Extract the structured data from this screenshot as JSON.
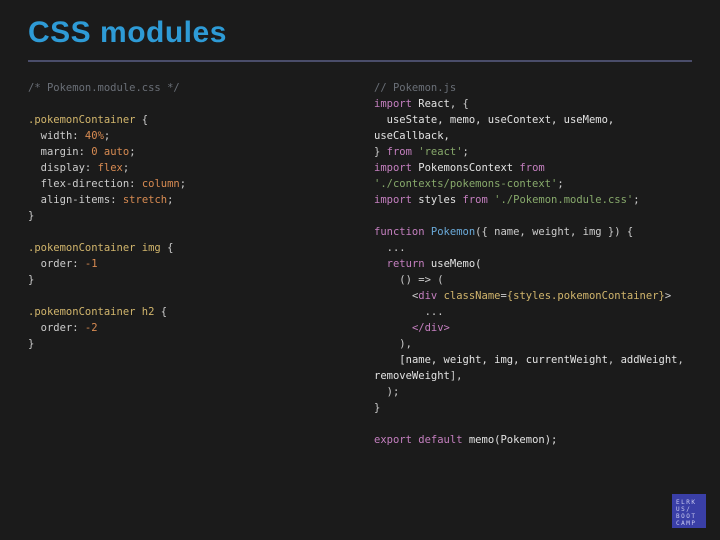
{
  "title": "CSS modules",
  "left": {
    "file": "Pokemon.module.css",
    "comment": "/* Pokemon.module.css */",
    "rules": [
      {
        "selector": ".pokemonContainer",
        "decls": [
          {
            "p": "width",
            "v": "40%"
          },
          {
            "p": "margin",
            "v": "0 auto"
          },
          {
            "p": "display",
            "v": "flex"
          },
          {
            "p": "flex-direction",
            "v": "column"
          },
          {
            "p": "align-items",
            "v": "stretch"
          }
        ]
      },
      {
        "selector": ".pokemonContainer img",
        "decls": [
          {
            "p": "order",
            "v": "-1"
          }
        ]
      },
      {
        "selector": ".pokemonContainer h2",
        "decls": [
          {
            "p": "order",
            "v": "-2"
          }
        ]
      }
    ]
  },
  "right": {
    "file": "Pokemon.js",
    "comment": "// Pokemon.js",
    "import1a": "import",
    "import1b": "React",
    "import1c": ", {",
    "importHooks": "useState, memo, useContext, useMemo, useCallback,",
    "import1d": "} ",
    "from": "from",
    "reactPkg": "'react'",
    "semi": ";",
    "import2a": "import",
    "import2b": "PokemonsContext",
    "ctxPkg": "'./contexts/pokemons-context'",
    "import3a": "import",
    "import3b": "styles",
    "cssPkg": "'./Pokemon.module.css'",
    "fnKw": "function",
    "fnName": "Pokemon",
    "fnArgs": "({ name, weight, img }) {",
    "dots": "...",
    "returnKw": "return",
    "useMemo": "useMemo(",
    "arrow": "() => (",
    "jsxOpen_lt": "<",
    "jsxTag": "div",
    "jsxAttr": "className",
    "jsxEq": "=",
    "jsxExprO": "{styles.pokemonContainer}",
    "jsxGt": ">",
    "jsxInner": "...",
    "jsxClose": "</div>",
    "closeParen": "),",
    "deps1": "[name, weight, img, ",
    "deps2a": "currentWeight",
    "deps2b": ", ",
    "deps2c": "addWeight",
    "deps2d": ", ",
    "deps3": "removeWeight",
    "deps4": "],",
    "closeCall": ");",
    "closeFn": "}",
    "exportKw": "export",
    "defaultKw": "default",
    "memoCall": "memo(Pokemon);"
  },
  "logo": {
    "l1": "ELRK",
    "l2": "US/",
    "l3": "BOOT",
    "l4": "CAMP"
  }
}
